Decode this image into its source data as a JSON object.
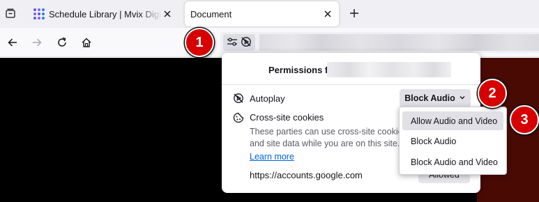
{
  "tabs": [
    {
      "title": "Schedule Library | Mvix Digital Signage",
      "active": false
    },
    {
      "title": "Document",
      "active": true
    }
  ],
  "panel": {
    "title": "Permissions for",
    "autoplay": {
      "label": "Autoplay",
      "value": "Block Audio"
    },
    "cookies": {
      "label": "Cross-site cookies",
      "description": "These parties can use cross-site cookies and site data while you are on this site.",
      "learn_more": "Learn more",
      "site": "https://accounts.google.com",
      "site_status": "Allowed"
    }
  },
  "dropdown": {
    "options": [
      "Allow Audio and Video",
      "Block Audio",
      "Block Audio and Video"
    ],
    "highlighted": "Allow Audio and Video"
  },
  "callouts": [
    "1",
    "2",
    "3"
  ],
  "colors": {
    "callout": "#d70000",
    "link": "#0061e0",
    "content_bg": "#000000",
    "content_right": "#4a0a04"
  }
}
